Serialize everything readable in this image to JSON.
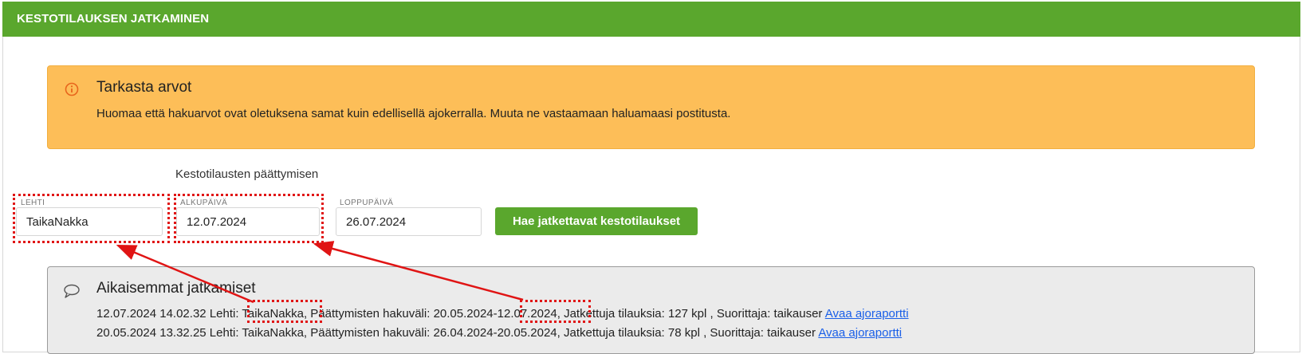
{
  "header": {
    "title": "KESTOTILAUKSEN JATKAMINEN"
  },
  "alert": {
    "icon": "info-icon",
    "title": "Tarkasta arvot",
    "text": "Huomaa että hakuarvot ovat oletuksena samat kuin edellisellä ajokerralla. Muuta ne vastaamaan haluamaasi postitusta."
  },
  "form": {
    "group_label": "Kestotilausten päättymisen",
    "lehti": {
      "label": "LEHTI",
      "value": "TaikaNakka"
    },
    "alkupaiva": {
      "label": "ALKUPÄIVÄ",
      "value": "12.07.2024"
    },
    "loppupaiva": {
      "label": "LOPPUPÄIVÄ",
      "value": "26.07.2024"
    },
    "search_button": "Hae jatkettavat kestotilaukset"
  },
  "history": {
    "icon": "comment-icon",
    "title": "Aikaisemmat jatkamiset",
    "rows": [
      {
        "timestamp": "12.07.2024 14.02.32",
        "lehti_label": "Lehti:",
        "lehti": "TaikaNakka",
        "range_label": ", Päättymisten hakuväli:",
        "range_start": "20.05.2024",
        "range_end": "12.07.2024",
        "stats": "Jatkettuja tilauksia: 127 kpl , Suorittaja: taikauser",
        "link": "Avaa ajoraportti"
      },
      {
        "text": "20.05.2024 13.32.25 Lehti: TaikaNakka, Päättymisten hakuväli: 26.04.2024-20.05.2024, Jatkettuja tilauksia: 78 kpl , Suorittaja: taikauser",
        "link": "Avaa ajoraportti"
      }
    ]
  },
  "colors": {
    "header_bg": "#5aa72d",
    "alert_bg": "#fdbe58",
    "button_bg": "#5aa72d",
    "annotation": "#e01414",
    "link": "#1a5fe8"
  }
}
